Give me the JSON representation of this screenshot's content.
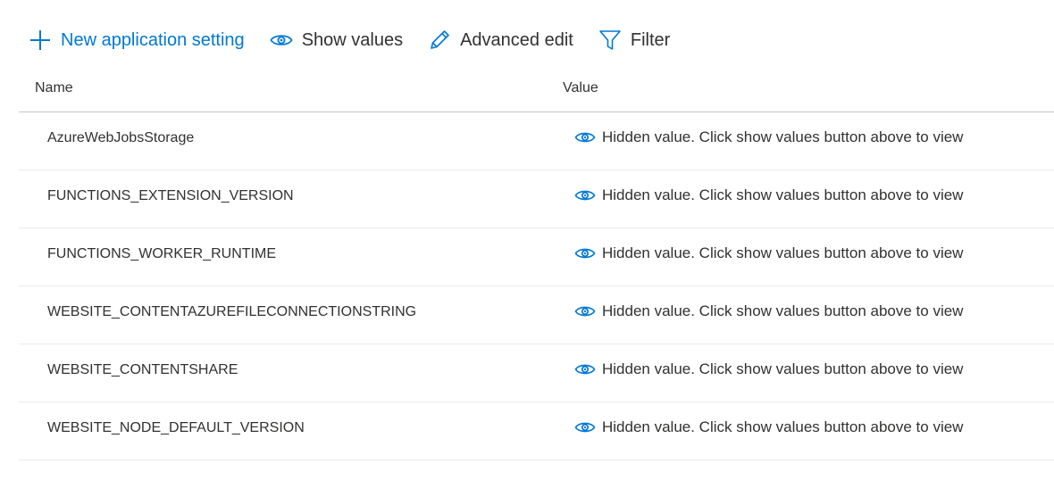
{
  "toolbar": {
    "new_setting_label": "New application setting",
    "show_values_label": "Show values",
    "advanced_edit_label": "Advanced edit",
    "filter_label": "Filter"
  },
  "table": {
    "headers": {
      "name": "Name",
      "value": "Value"
    },
    "rows": [
      {
        "name": "AzureWebJobsStorage",
        "value": "Hidden value. Click show values button above to view"
      },
      {
        "name": "FUNCTIONS_EXTENSION_VERSION",
        "value": "Hidden value. Click show values button above to view"
      },
      {
        "name": "FUNCTIONS_WORKER_RUNTIME",
        "value": "Hidden value. Click show values button above to view"
      },
      {
        "name": "WEBSITE_CONTENTAZUREFILECONNECTIONSTRING",
        "value": "Hidden value. Click show values button above to view"
      },
      {
        "name": "WEBSITE_CONTENTSHARE",
        "value": "Hidden value. Click show values button above to view"
      },
      {
        "name": "WEBSITE_NODE_DEFAULT_VERSION",
        "value": "Hidden value. Click show values button above to view"
      }
    ]
  },
  "icons": {
    "add": "plus-icon",
    "show": "eye-icon",
    "edit": "pencil-icon",
    "filter": "filter-icon",
    "hidden_value": "eye-icon"
  },
  "colors": {
    "accent": "#0078d4",
    "text": "#323130",
    "header_border": "#c8c6c4",
    "row_border": "#edebe9"
  }
}
